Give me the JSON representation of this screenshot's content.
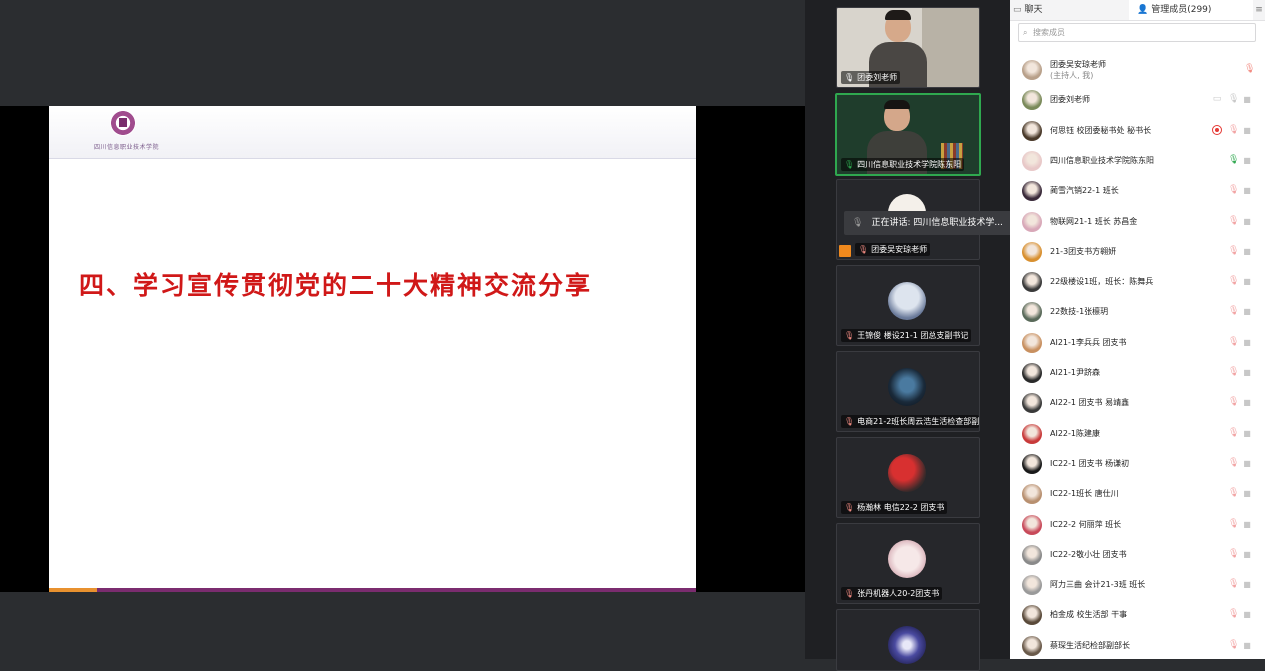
{
  "slide": {
    "logo_text": "四川信息职业技术学院",
    "title": "四、学习宣传贯彻党的二十大精神交流分享"
  },
  "video_tiles": [
    {
      "name": "团委刘老师",
      "mic": "on"
    },
    {
      "name": "四川信息职业技术学院陈东阳",
      "mic": "speaking"
    },
    {
      "name": "团委吴安琼老师",
      "mic": "off"
    },
    {
      "name": "王锦俊 楼设21-1 团总支副书记",
      "mic": "off"
    },
    {
      "name": "电商21-2班长周云浩生活检查部副...",
      "mic": "off"
    },
    {
      "name": "杨瀚林 电信22-2 团支书",
      "mic": "off"
    },
    {
      "name": "张丹机器人20-2团支书",
      "mic": "off"
    }
  ],
  "speaking_tooltip": "正在讲话: 四川信息职业技术学...",
  "members_panel": {
    "tab_chat": "聊天",
    "tab_members": "管理成员(299)",
    "search_placeholder": "搜索成员",
    "members": [
      {
        "name": "团委吴安琼老师",
        "sub": "(主持人, 我)",
        "color": "#b8a08a"
      },
      {
        "name": "团委刘老师",
        "color": "#7a8a5a"
      },
      {
        "name": "何思钰  校团委秘书处  秘书长",
        "color": "#4a3a2a"
      },
      {
        "name": "四川信息职业技术学院陈东阳",
        "color": "#e8c8c8"
      },
      {
        "name": "蔺雪汽销22-1 班长",
        "color": "#3a2a3a"
      },
      {
        "name": "物联网21-1 班长 苏昌金",
        "color": "#d8a8b8"
      },
      {
        "name": "21-3团支书方翱妍",
        "color": "#d89030"
      },
      {
        "name": "22级楼设1班，班长：陈舞兵",
        "color": "#3a3a3a"
      },
      {
        "name": "22数技-1张檩玥",
        "color": "#5a6a5a"
      },
      {
        "name": "AI21-1李兵兵 团支书",
        "color": "#c89060"
      },
      {
        "name": "AI21-1尹跻森",
        "color": "#2a2a2a"
      },
      {
        "name": "AI22-1  团支书  易靖鑫",
        "color": "#3a3a3a"
      },
      {
        "name": "AI22-1陈建康",
        "color": "#c83a3a"
      },
      {
        "name": "IC22-1 团支书  杨谦初",
        "color": "#1a1a1a"
      },
      {
        "name": "IC22-1班长 唐仕川",
        "color": "#b89070"
      },
      {
        "name": "IC22-2 何丽萍 班长",
        "color": "#c84a5a"
      },
      {
        "name": "IC22-2敬小壮  团支书",
        "color": "#8a8a8a"
      },
      {
        "name": "阿力三曲  会计21-3班  班长",
        "color": "#9a9a9a"
      },
      {
        "name": "柏金成  校生活部  干事",
        "color": "#5a4a3a"
      },
      {
        "name": "蔡琛生活纪检部副部长",
        "color": "#6a5a4a"
      }
    ]
  }
}
